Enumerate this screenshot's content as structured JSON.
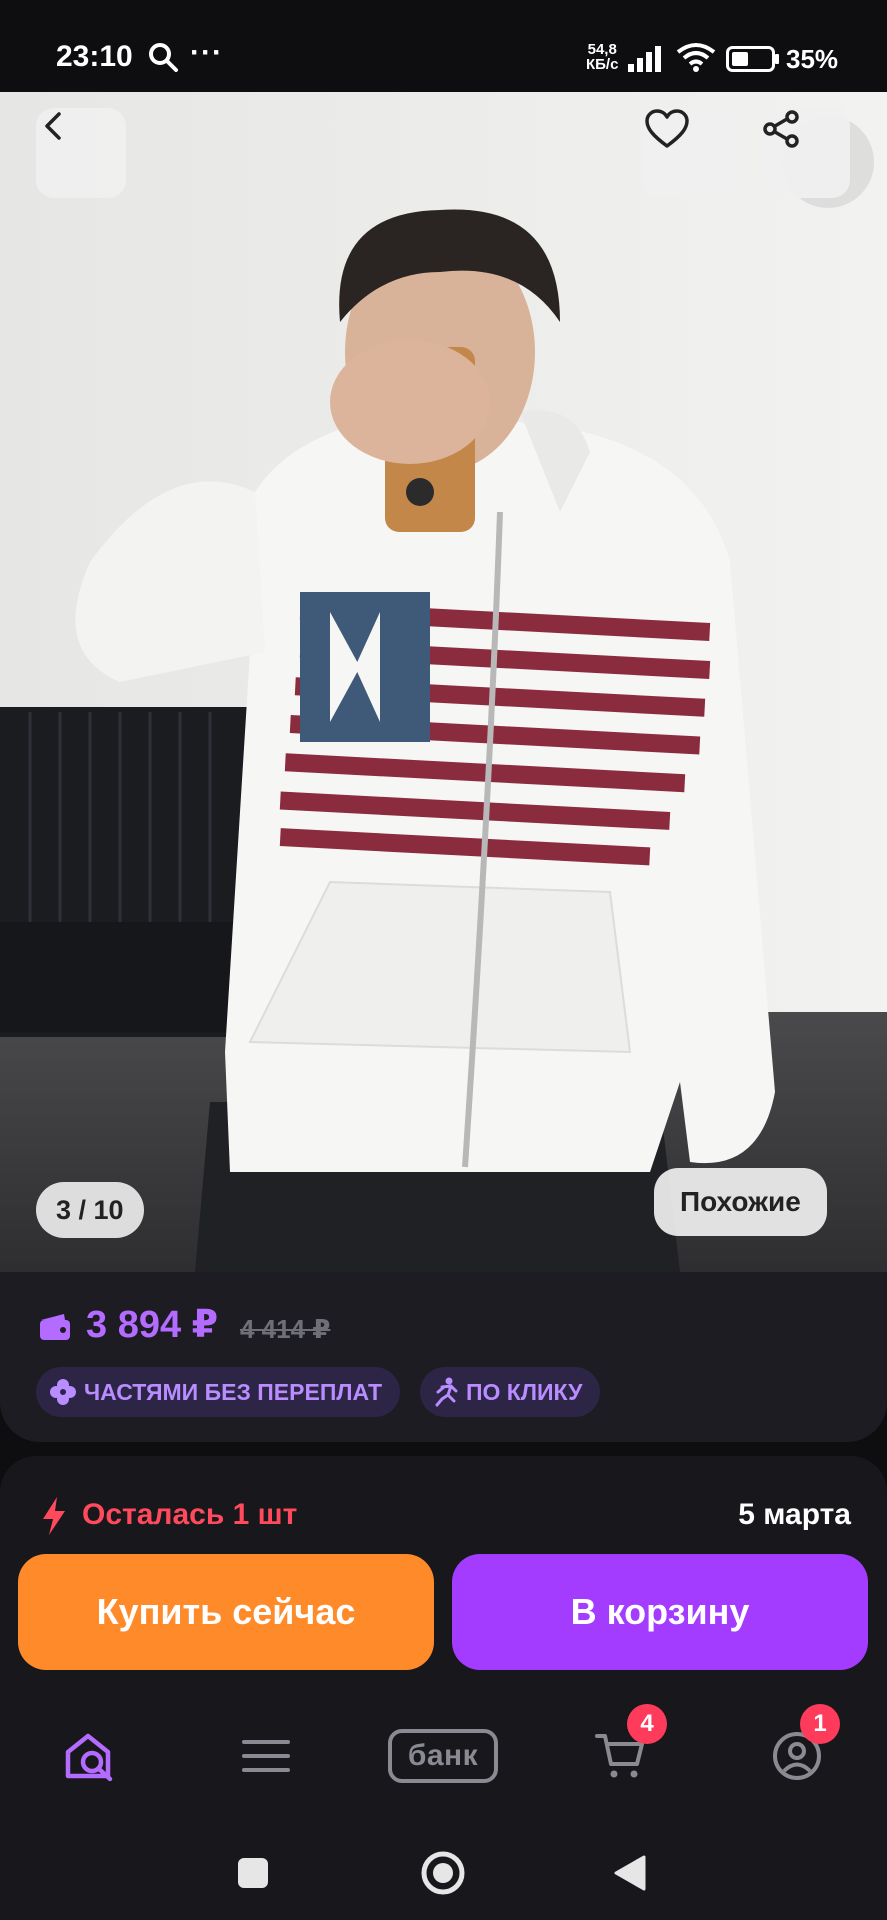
{
  "status_bar": {
    "time": "23:10",
    "net_speed_value": "54,8",
    "net_speed_unit": "КБ/с",
    "battery": "35%"
  },
  "gallery": {
    "counter": "3 / 10",
    "similar_label": "Похожие"
  },
  "price": {
    "current": "3 894 ₽",
    "old": "4 414 ₽",
    "accent_color": "#b46bff"
  },
  "badges": [
    {
      "label": "ЧАСТЯМИ БЕЗ ПЕРЕПЛАТ",
      "icon": "clover-icon"
    },
    {
      "label": "ПО КЛИКУ",
      "icon": "running-person-icon"
    }
  ],
  "stock": {
    "text": "Осталась 1 шт",
    "delivery_date": "5 марта",
    "color": "#ff4a5e"
  },
  "actions": {
    "buy_now": "Купить сейчас",
    "add_to_cart": "В корзину",
    "buy_color": "#ff8a2a",
    "cart_color": "#a33cff"
  },
  "tabbar": {
    "home_icon": "home-search-icon",
    "menu_icon": "menu-icon",
    "bank_label": "банк",
    "cart_icon": "cart-icon",
    "cart_count": "4",
    "profile_icon": "profile-icon",
    "profile_count": "1"
  }
}
